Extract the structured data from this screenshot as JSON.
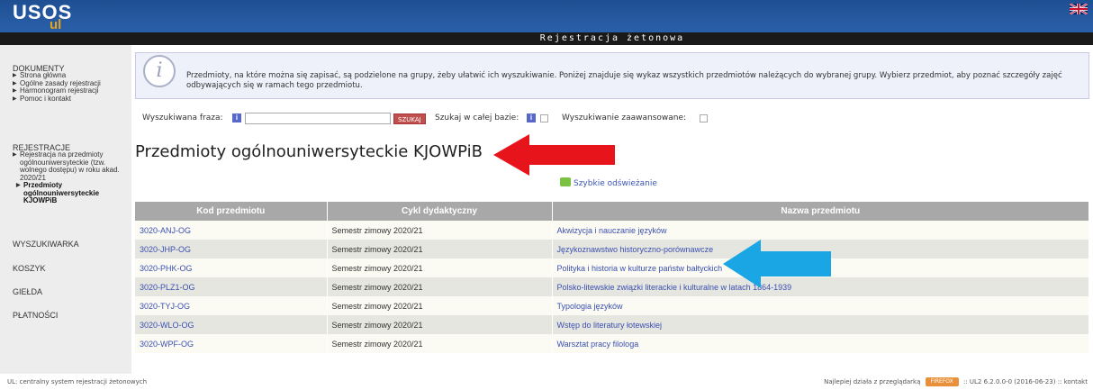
{
  "header": {
    "logo": "USOS",
    "logo_sub": "ul",
    "title": "Rejestracja żetonowa"
  },
  "sidebar": {
    "dokumenty": {
      "heading": "DOKUMENTY",
      "items": [
        "Strona główna",
        "Ogólne zasady rejestracji",
        "Harmonogram rejestracji",
        "Pomoc i kontakt"
      ]
    },
    "rejestracje": {
      "heading": "REJESTRACJE",
      "items": [
        "Rejestracja na przedmioty ogólnouniwersyteckie (tzw. wolnego dostępu) w roku akad. 2020/21"
      ],
      "active": "Przedmioty ogólnouniwersyteckie KJOWPiB"
    },
    "links": [
      "WYSZUKIWARKA",
      "KOSZYK",
      "GIEŁDA",
      "PŁATNOŚCI"
    ]
  },
  "info": {
    "text": "Przedmioty, na które można się zapisać, są podzielone na grupy, żeby ułatwić ich wyszukiwanie. Poniżej znajduje się wykaz wszystkich przedmiotów należących do wybranej grupy. Wybierz przedmiot, aby poznać szczegóły zajęć odbywających się w ramach tego przedmiotu."
  },
  "search": {
    "label": "Wyszukiwana fraza:",
    "value": "",
    "button": "SZUKAJ",
    "whole_db_label": "Szukaj w całej bazie:",
    "advanced_label": "Wyszukiwanie zaawansowane:",
    "info_glyph": "i"
  },
  "page_heading": "Przedmioty ogólnouniwersyteckie KJOWPiB",
  "refresh_label": "Szybkie odświeżanie",
  "table": {
    "headers": [
      "Kod przedmiotu",
      "Cykl dydaktyczny",
      "Nazwa przedmiotu"
    ],
    "rows": [
      {
        "code": "3020-ANJ-OG",
        "cycle": "Semestr zimowy 2020/21",
        "name": "Akwizycja i nauczanie języków"
      },
      {
        "code": "3020-JHP-OG",
        "cycle": "Semestr zimowy 2020/21",
        "name": "Językoznawstwo historyczno-porównawcze"
      },
      {
        "code": "3020-PHK-OG",
        "cycle": "Semestr zimowy 2020/21",
        "name": "Polityka i historia w kulturze państw bałtyckich"
      },
      {
        "code": "3020-PLZ1-OG",
        "cycle": "Semestr zimowy 2020/21",
        "name": "Polsko-litewskie związki literackie i kulturalne w latach 1864-1939"
      },
      {
        "code": "3020-TYJ-OG",
        "cycle": "Semestr zimowy 2020/21",
        "name": "Typologia języków"
      },
      {
        "code": "3020-WLO-OG",
        "cycle": "Semestr zimowy 2020/21",
        "name": "Wstęp do literatury łotewskiej"
      },
      {
        "code": "3020-WPF-OG",
        "cycle": "Semestr zimowy 2020/21",
        "name": "Warsztat pracy filologa"
      }
    ]
  },
  "footer": {
    "left": "UL: centralny system rejestracji żetonowych",
    "browser_note": "Najlepiej działa z przeglądarką",
    "browser_badge": "FIREFOX",
    "version": ":: UL2 6.2.0.0-0 (2016-06-23)",
    "contact": ":: kontakt"
  },
  "colors": {
    "header_blue": "#2a60a9",
    "accent_red": "#e8141b",
    "accent_blue": "#1aa6e4",
    "link": "#3b4fb0"
  }
}
